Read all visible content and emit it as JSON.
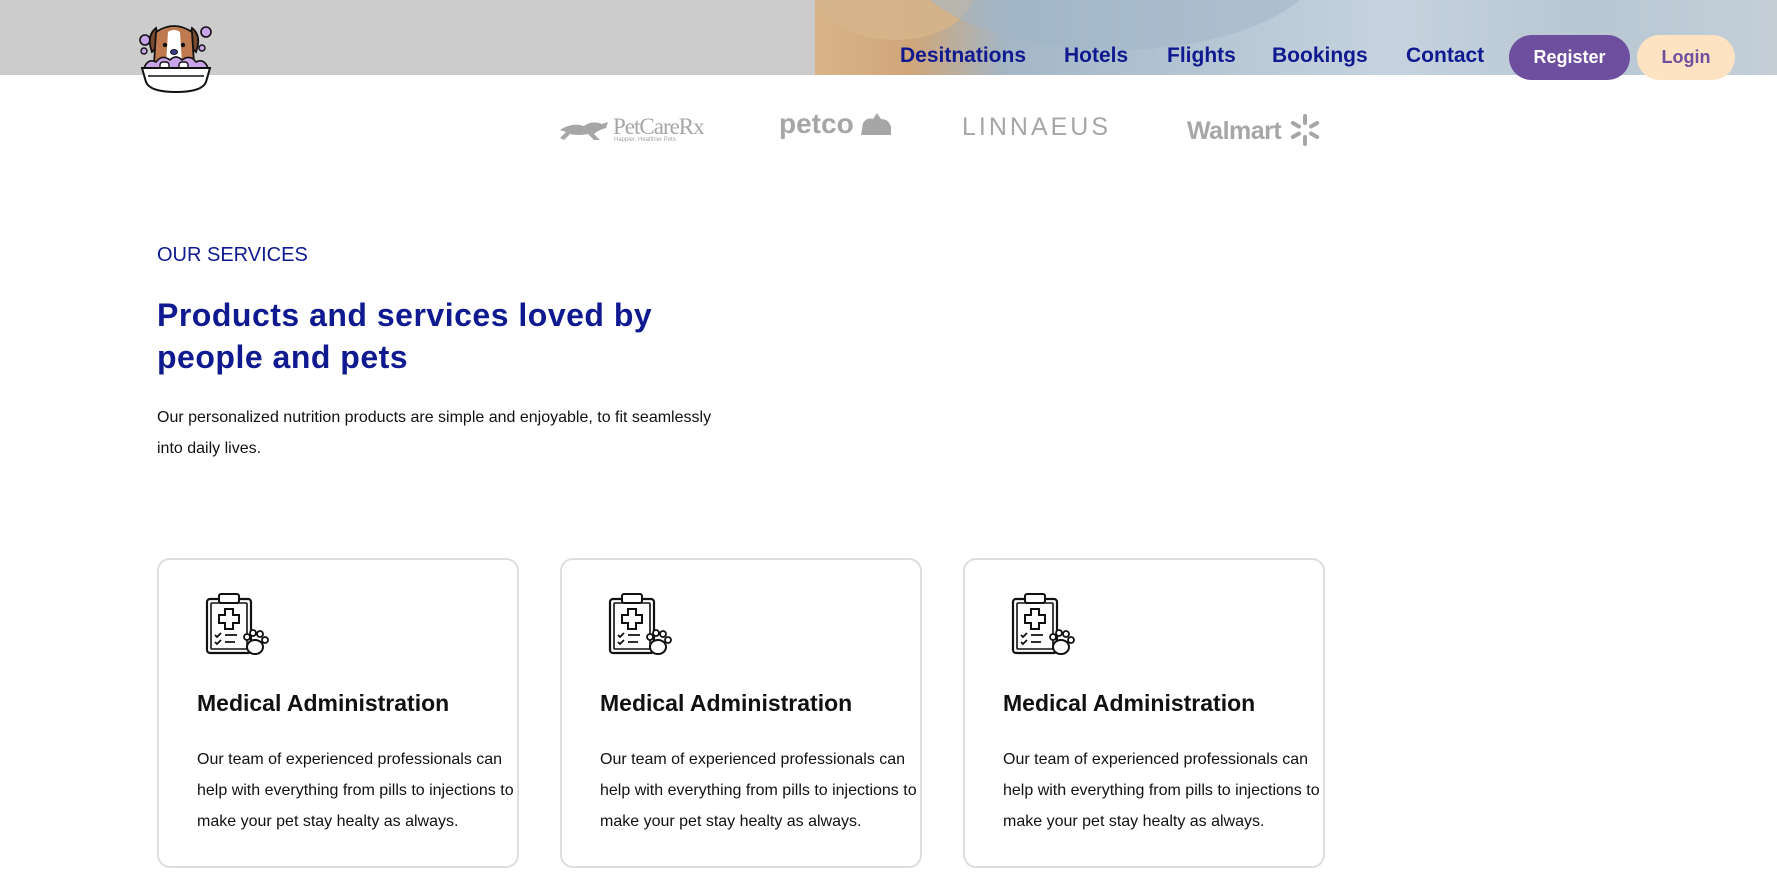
{
  "header": {
    "nav": [
      "Desitnations",
      "Hotels",
      "Flights",
      "Bookings",
      "Contact"
    ],
    "register_label": "Register",
    "login_label": "Login",
    "logo_icon": "dog-in-bathtub-logo-icon"
  },
  "partners": {
    "petcare": {
      "name": "PetCareRx",
      "tagline": "Happier. Healthier Pets."
    },
    "petco": "petco",
    "linnaeus": "LINNAEUS",
    "walmart": "Walmart"
  },
  "services": {
    "eyebrow": "OUR SERVICES",
    "headline": "Products and services loved by people and pets",
    "intro": "Our personalized nutrition products are simple and enjoyable, to fit seamlessly into daily lives.",
    "cards": [
      {
        "icon": "medical-clipboard-paw-icon",
        "title": "Medical Administration",
        "body": "Our team of experienced professionals can help with everything from pills to injections to make your pet stay healty as always."
      },
      {
        "icon": "medical-clipboard-paw-icon",
        "title": "Medical Administration",
        "body": "Our team of experienced professionals can help with everything from pills to injections to make your pet stay healty as always."
      },
      {
        "icon": "medical-clipboard-paw-icon",
        "title": "Medical Administration",
        "body": "Our team of experienced professionals can help with everything from pills to injections to make your pet stay healty as always."
      }
    ]
  },
  "colors": {
    "brand_navy": "#0f1990",
    "register_purple": "#6e4e9e",
    "login_peach": "#fde3c2",
    "header_gray": "#cccccc"
  }
}
